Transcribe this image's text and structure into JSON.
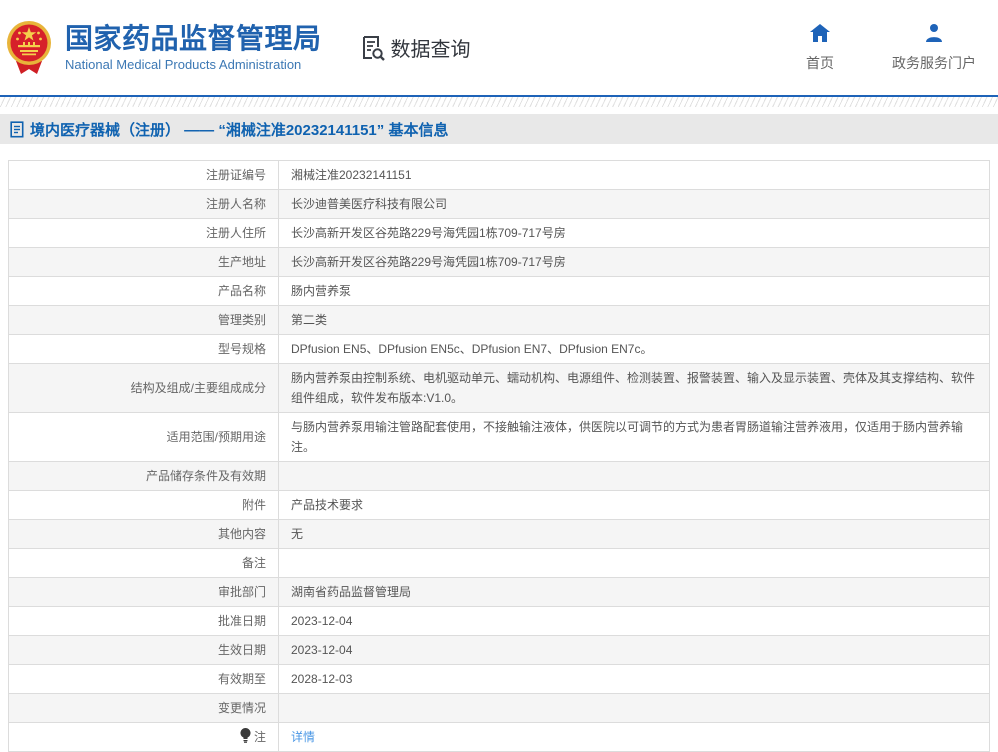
{
  "colors": {
    "brand_blue": "#2062ae",
    "accent_blue": "#1e63b8",
    "subtitle_blue": "#3c78b4",
    "breadcrumb_blue": "#0f62b0",
    "link_blue": "#4a97e5",
    "row_alt_bg": "#f5f5f5",
    "border_gray": "#dcdcdc",
    "breadcrumb_bg": "#e8e8e8"
  },
  "header": {
    "org_title": "国家药品监督管理局",
    "org_subtitle": "National Medical Products Administration",
    "section_label": "数据查询",
    "nav": [
      {
        "label": "首页",
        "icon": "home-icon"
      },
      {
        "label": "政务服务门户",
        "icon": "user-icon"
      }
    ]
  },
  "breadcrumb": {
    "text": "境内医疗器械（注册） —— “湘械注准20232141151” 基本信息",
    "icon": "document-icon"
  },
  "table": {
    "rows": [
      {
        "label": "注册证编号",
        "value": "湘械注准20232141151"
      },
      {
        "label": "注册人名称",
        "value": "长沙迪普美医疗科技有限公司"
      },
      {
        "label": "注册人住所",
        "value": "长沙高新开发区谷苑路229号海凭园1栋709-717号房"
      },
      {
        "label": "生产地址",
        "value": "长沙高新开发区谷苑路229号海凭园1栋709-717号房"
      },
      {
        "label": "产品名称",
        "value": "肠内营养泵"
      },
      {
        "label": "管理类别",
        "value": "第二类"
      },
      {
        "label": "型号规格",
        "value": "DPfusion EN5、DPfusion EN5c、DPfusion EN7、DPfusion EN7c。"
      },
      {
        "label": "结构及组成/主要组成成分",
        "value": "肠内营养泵由控制系统、电机驱动单元、蠕动机构、电源组件、检测装置、报警装置、输入及显示装置、壳体及其支撑结构、软件组件组成，软件发布版本:V1.0。"
      },
      {
        "label": "适用范围/预期用途",
        "value": "与肠内营养泵用输注管路配套使用，不接触输注液体，供医院以可调节的方式为患者胃肠道输注营养液用，仅适用于肠内营养输注。"
      },
      {
        "label": "产品储存条件及有效期",
        "value": ""
      },
      {
        "label": "附件",
        "value": "产品技术要求"
      },
      {
        "label": "其他内容",
        "value": "无"
      },
      {
        "label": "备注",
        "value": ""
      },
      {
        "label": "审批部门",
        "value": "湖南省药品监督管理局"
      },
      {
        "label": "批准日期",
        "value": "2023-12-04"
      },
      {
        "label": "生效日期",
        "value": "2023-12-04"
      },
      {
        "label": "有效期至",
        "value": "2028-12-03"
      },
      {
        "label": "变更情况",
        "value": ""
      },
      {
        "label": "注",
        "label_icon": "bulb-icon",
        "value": "详情",
        "value_is_link": true
      }
    ]
  }
}
